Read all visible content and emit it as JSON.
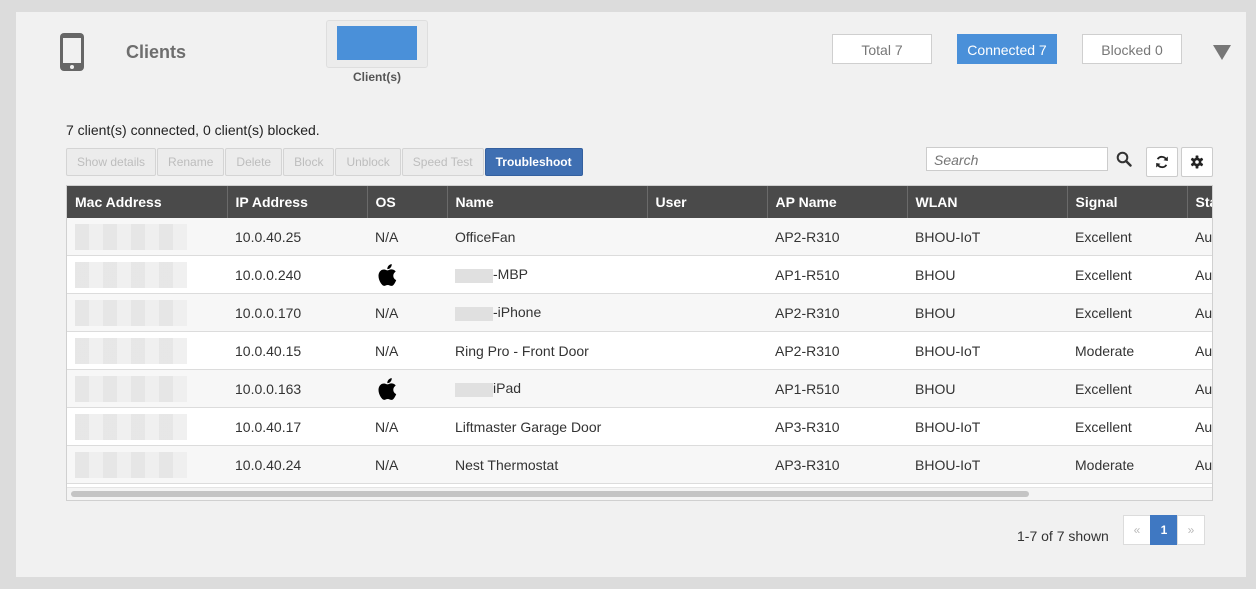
{
  "header": {
    "title": "Clients",
    "legend_label": "Client(s)",
    "filters": [
      {
        "label": "Total 7",
        "active": false
      },
      {
        "label": "Connected 7",
        "active": true
      },
      {
        "label": "Blocked 0",
        "active": false
      }
    ]
  },
  "summary": "7 client(s) connected, 0 client(s) blocked.",
  "actions": [
    "Show details",
    "Rename",
    "Delete",
    "Block",
    "Unblock",
    "Speed Test",
    "Troubleshoot"
  ],
  "search": {
    "placeholder": "Search"
  },
  "table": {
    "columns": [
      "Mac Address",
      "IP Address",
      "OS",
      "Name",
      "User",
      "AP Name",
      "WLAN",
      "Signal",
      "Status"
    ],
    "rows": [
      {
        "ip": "10.0.40.25",
        "os": "N/A",
        "os_icon": "",
        "name_prefix_redacted": false,
        "name": "OfficeFan",
        "user": "",
        "ap": "AP2-R310",
        "wlan": "BHOU-IoT",
        "signal": "Excellent",
        "status": "Au"
      },
      {
        "ip": "10.0.0.240",
        "os": "",
        "os_icon": "apple-icon",
        "name_prefix_redacted": true,
        "name": "-MBP",
        "user": "",
        "ap": "AP1-R510",
        "wlan": "BHOU",
        "signal": "Excellent",
        "status": "Au"
      },
      {
        "ip": "10.0.0.170",
        "os": "N/A",
        "os_icon": "",
        "name_prefix_redacted": true,
        "name": "-iPhone",
        "user": "",
        "ap": "AP2-R310",
        "wlan": "BHOU",
        "signal": "Excellent",
        "status": "Au"
      },
      {
        "ip": "10.0.40.15",
        "os": "N/A",
        "os_icon": "",
        "name_prefix_redacted": false,
        "name": "Ring Pro - Front Door",
        "user": "",
        "ap": "AP2-R310",
        "wlan": "BHOU-IoT",
        "signal": "Moderate",
        "status": "Au"
      },
      {
        "ip": "10.0.0.163",
        "os": "",
        "os_icon": "apple-icon",
        "name_prefix_redacted": true,
        "name": "iPad",
        "user": "",
        "ap": "AP1-R510",
        "wlan": "BHOU",
        "signal": "Excellent",
        "status": "Au"
      },
      {
        "ip": "10.0.40.17",
        "os": "N/A",
        "os_icon": "",
        "name_prefix_redacted": false,
        "name": "Liftmaster Garage Door",
        "user": "",
        "ap": "AP3-R310",
        "wlan": "BHOU-IoT",
        "signal": "Excellent",
        "status": "Au"
      },
      {
        "ip": "10.0.40.24",
        "os": "N/A",
        "os_icon": "",
        "name_prefix_redacted": false,
        "name": "Nest Thermostat",
        "user": "",
        "ap": "AP3-R310",
        "wlan": "BHOU-IoT",
        "signal": "Moderate",
        "status": "Au"
      }
    ]
  },
  "pagination": {
    "shown": "1-7 of 7 shown",
    "prev": "«",
    "current": "1",
    "next": "»"
  },
  "colors": {
    "accent": "#4a90d9",
    "header_bg": "#4a4a4a",
    "primary_button": "#3f6fb2"
  }
}
